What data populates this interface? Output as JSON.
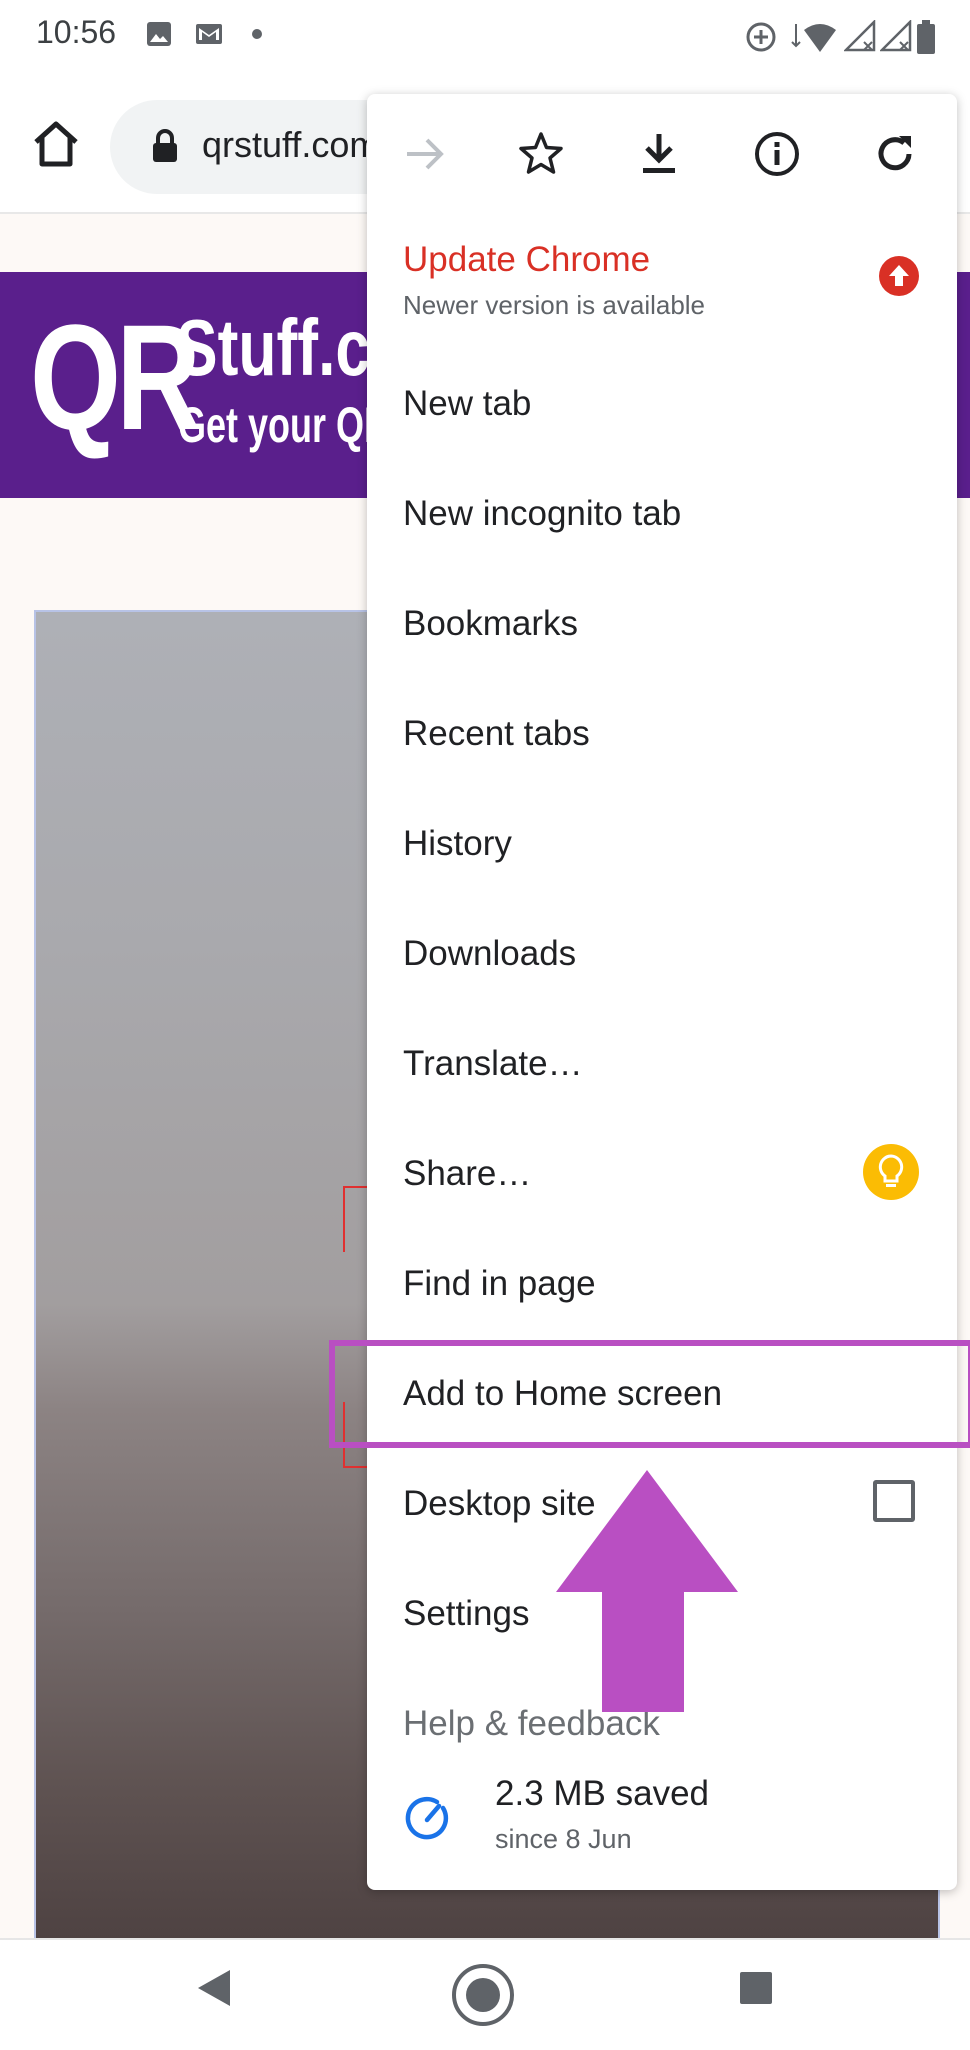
{
  "status_bar": {
    "time": "10:56"
  },
  "toolbar": {
    "url": "qrstuff.com"
  },
  "page": {
    "logo_qr": "QR",
    "logo_name": "Stuff.com",
    "logo_tagline": "Get your QR code"
  },
  "menu": {
    "update": {
      "title": "Update Chrome",
      "subtitle": "Newer version is available"
    },
    "items": [
      "New tab",
      "New incognito tab",
      "Bookmarks",
      "Recent tabs",
      "History",
      "Downloads",
      "Translate…",
      "Share…",
      "Find in page",
      "Add to Home screen",
      "Desktop site",
      "Settings",
      "Help & feedback"
    ],
    "desktop_site_checked": false,
    "data_saver": {
      "amount": "2.3 MB saved",
      "since": "since 8 Jun"
    }
  },
  "icons": {
    "toolbar": [
      "home-icon",
      "lock-icon"
    ],
    "menu_top": [
      "forward-arrow-icon",
      "star-icon",
      "download-icon",
      "info-icon",
      "refresh-icon"
    ],
    "nav": [
      "back-icon",
      "home-circle-icon",
      "recents-icon"
    ]
  },
  "colors": {
    "update_red": "#d93025",
    "highlight_purple": "#b94fc2",
    "banner_purple": "#5a1f8c",
    "bulb_yellow": "#fbbc04",
    "saver_blue": "#1a73e8"
  }
}
